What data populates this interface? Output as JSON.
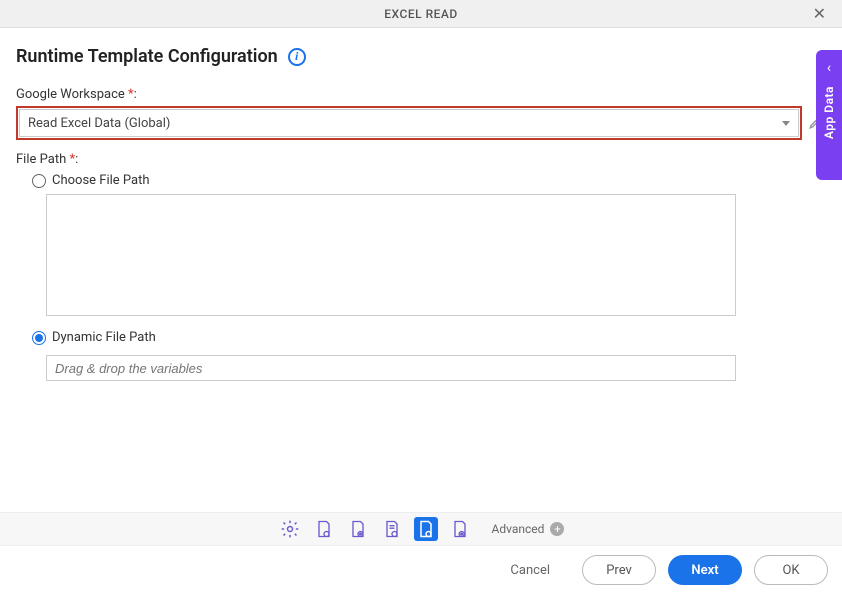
{
  "header": {
    "title": "EXCEL READ"
  },
  "page": {
    "title": "Runtime Template Configuration"
  },
  "fields": {
    "workspace_label": "Google Workspace ",
    "workspace_value": "Read Excel Data (Global)",
    "filepath_label": "File Path ",
    "choose_label": "Choose File Path",
    "dynamic_label": "Dynamic File Path",
    "dynamic_placeholder": "Drag & drop the variables"
  },
  "toolbar": {
    "advanced_label": "Advanced"
  },
  "footer": {
    "cancel": "Cancel",
    "prev": "Prev",
    "next": "Next",
    "ok": "OK"
  },
  "side": {
    "label": "App Data"
  }
}
